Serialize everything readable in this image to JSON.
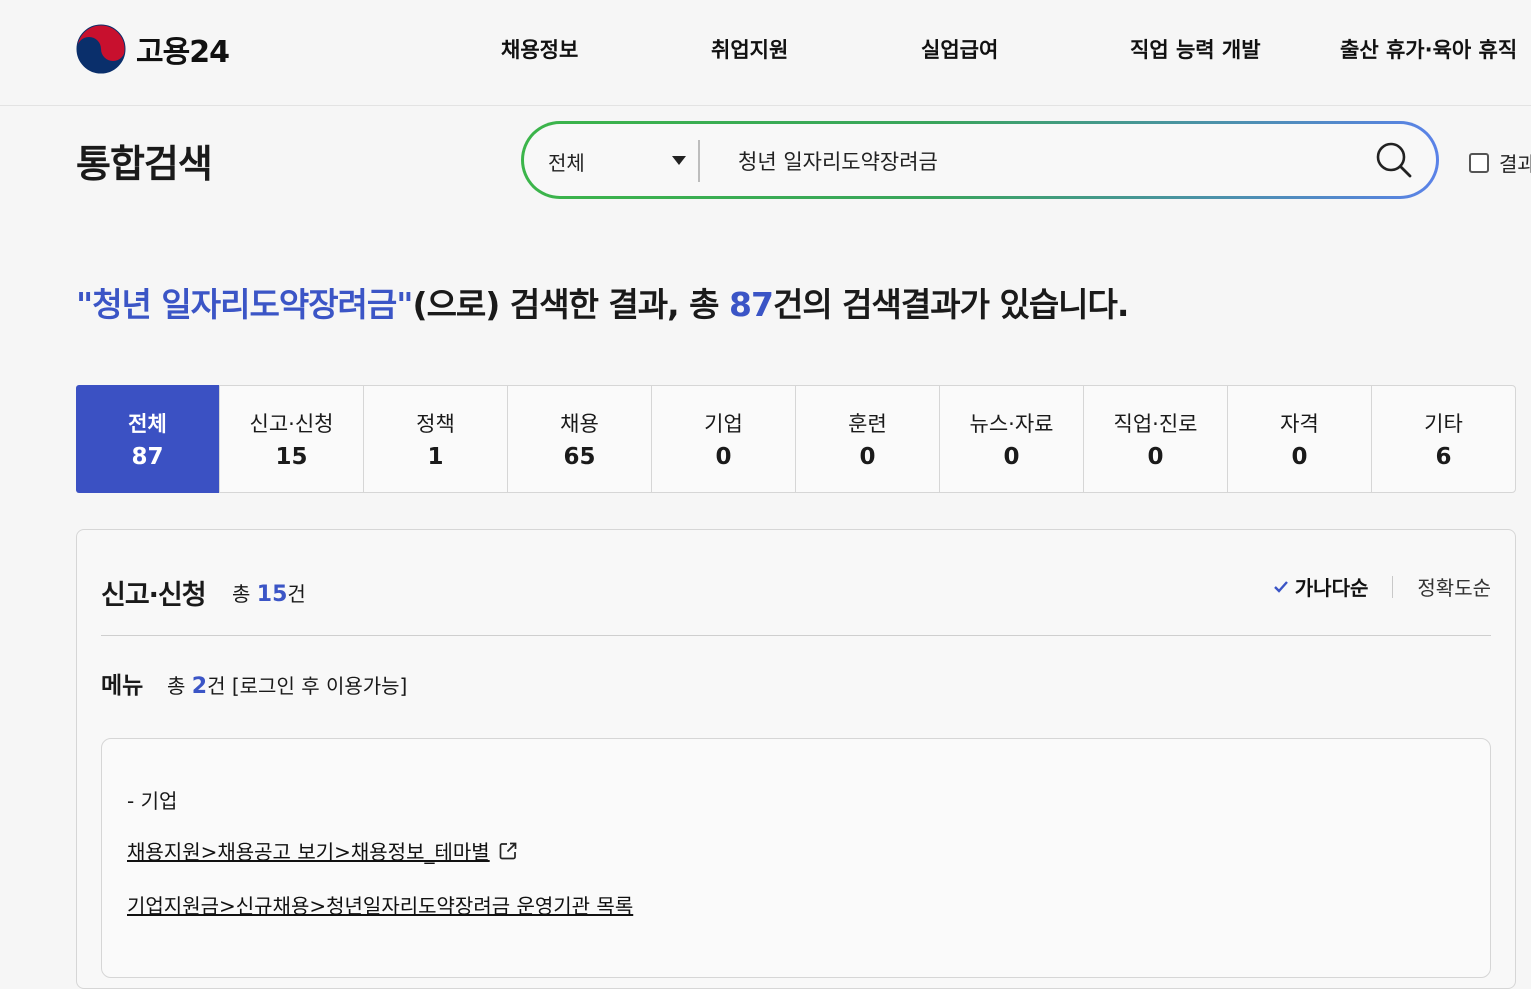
{
  "header": {
    "logo_text": "고용24",
    "nav": [
      "채용정보",
      "취업지원",
      "실업급여",
      "직업 능력 개발",
      "출산 휴가·육아 휴직"
    ]
  },
  "search": {
    "page_title": "통합검색",
    "scope": "전체",
    "query": "청년 일자리도약장려금",
    "within_label": "결과"
  },
  "summary": {
    "query_quoted": "\"청년 일자리도약장려금\"",
    "middle": "(으로) 검색한 결과, 총 ",
    "total": "87",
    "tail": "건의 검색결과가 있습니다."
  },
  "tabs": [
    {
      "name": "전체",
      "count": "87"
    },
    {
      "name": "신고·신청",
      "count": "15"
    },
    {
      "name": "정책",
      "count": "1"
    },
    {
      "name": "채용",
      "count": "65"
    },
    {
      "name": "기업",
      "count": "0"
    },
    {
      "name": "훈련",
      "count": "0"
    },
    {
      "name": "뉴스·자료",
      "count": "0"
    },
    {
      "name": "직업·진로",
      "count": "0"
    },
    {
      "name": "자격",
      "count": "0"
    },
    {
      "name": "기타",
      "count": "6"
    }
  ],
  "section": {
    "title": "신고·신청",
    "count_prefix": "총 ",
    "count": "15",
    "count_suffix": "건",
    "sort": [
      "가나다순",
      "정확도순"
    ]
  },
  "menu": {
    "title": "메뉴",
    "count_prefix": "총 ",
    "count": "2",
    "count_suffix": "건 [로그인 후 이용가능]",
    "category": "- 기업",
    "links": [
      "채용지원>채용공고 보기>채용정보_테마별",
      "기업지원금>신규채용>청년일자리도약장려금 운영기관 목록"
    ]
  },
  "colors": {
    "accent": "#3b51c3",
    "highlight": "#3b55c6"
  }
}
